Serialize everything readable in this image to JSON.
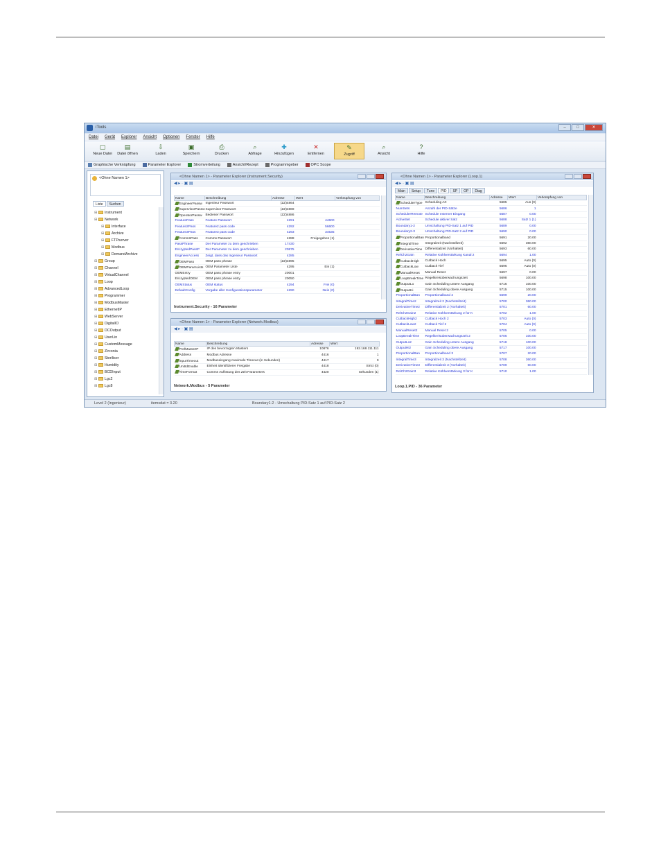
{
  "app": {
    "title": "iTools"
  },
  "menu": [
    "Datei",
    "Gerät",
    "Explorer",
    "Ansicht",
    "Optionen",
    "Fenster",
    "Hilfe"
  ],
  "toolbar": [
    {
      "label": "Neue Datei",
      "icon": "new-file-icon"
    },
    {
      "label": "Datei öffnen",
      "icon": "open-file-icon"
    },
    {
      "label": "Laden",
      "icon": "load-icon"
    },
    {
      "label": "Speichern",
      "icon": "save-icon"
    },
    {
      "label": "Drucken",
      "icon": "print-icon"
    },
    {
      "label": "Abfrage",
      "icon": "scan-icon"
    },
    {
      "label": "Hinzufügen",
      "icon": "add-icon"
    },
    {
      "label": "Entfernen",
      "icon": "remove-icon"
    },
    {
      "label": "Zugriff",
      "icon": "access-icon"
    },
    {
      "label": "Ansicht",
      "icon": "view-icon"
    },
    {
      "label": "Hilfe",
      "icon": "help-icon"
    }
  ],
  "views": [
    "Graphische Verknüpfung",
    "Parameter Explorer",
    "Stromverteilung",
    "Ansicht/Rezept",
    "Programmgeber",
    "OPC Scope"
  ],
  "tree": {
    "root": "<Ohne Namen 1>",
    "tabs": [
      "Liste",
      "Suchen"
    ],
    "items": [
      "Instrument",
      "Network",
      "Interface",
      "Archive",
      "FTPserver",
      "Modbus",
      "DemandArchive",
      "Group",
      "Channel",
      "VirtualChannel",
      "Loop",
      "AdvancedLoop",
      "Programmer",
      "ModbusMaster",
      "EthernetIP",
      "WebServer",
      "DigitalIO",
      "DCOutput",
      "UserLin",
      "CustomMessage",
      "Zirconia",
      "Steriliser",
      "Humidity",
      "BCDInput",
      "Lgc2",
      "Lgc8"
    ]
  },
  "security_panel": {
    "title": "<Ohne Namen 1> - Parameter Explorer (Instrument.Security)",
    "headers": [
      "Name",
      "Beschreibung",
      "Adresse",
      "Wert",
      "Verknüpfung von"
    ],
    "rows": [
      [
        "EngineerPassw",
        "Ingenieur Passwort",
        "(ZZ)4864",
        ""
      ],
      [
        "SupervisorPassw",
        "Supervisor Passwort",
        "(ZZ)4869",
        ""
      ],
      [
        "OperatorPassw",
        "Bediener Passwort",
        "(ZZ)4886",
        ""
      ],
      [
        "FeaturePass",
        "Feature Passwort",
        "4291",
        "44600"
      ],
      [
        "Feature2Pass",
        "Feature2 pass code",
        "4292",
        "56600"
      ],
      [
        "Feature3Pass",
        "Feature3 pass code",
        "4293",
        "34635"
      ],
      [
        "CommsPass",
        "Comms Passwort",
        "4288",
        "Freigegeben (1)"
      ],
      [
        "PassPhrase",
        "Der Parameter zu dem geschrieben",
        "17430",
        ""
      ],
      [
        "EncryptedPassP",
        "Der Parameter zu dem geschrieben",
        "20875",
        ""
      ],
      [
        "EngineerAccess",
        "Zeigt, dass das Ingenieur Passwort",
        "4285",
        ""
      ],
      [
        "OEMPass",
        "OEM pass phrase",
        "(ZZ)4895",
        ""
      ],
      [
        "OEMParamLists",
        "OEM Parameter Liste",
        "4295",
        "Ein (1)"
      ],
      [
        "OEMEntry",
        "OEM pass phrase entry",
        "20001",
        ""
      ],
      [
        "EncryptedOEM",
        "OEM pass phrase entry",
        "20050",
        ""
      ],
      [
        "OEMStatus",
        "OEM status",
        "4294",
        "Frei (0)"
      ],
      [
        "DefaultConfig",
        "Vorgabe aller Konfigurationsparameter",
        "4290",
        "Nein (0)"
      ]
    ],
    "status": "Instrument.Security",
    "count": "16 Parameter"
  },
  "modbus_panel": {
    "title": "<Ohne Namen 1> - Parameter Explorer (Network.Modbus)",
    "headers": [
      "Name",
      "Beschreibung",
      "Adresse",
      "Wert"
    ],
    "rows": [
      [
        "PrefMasterIP",
        "IP des bevorzugten Masters",
        "10876",
        "192.168.111.111"
      ],
      [
        "Address",
        "Modbus Adresse",
        "4416",
        "1"
      ],
      [
        "InputTimeout",
        "Modbuseingang maximale Timeout (in Sekunden)",
        "4417",
        "0"
      ],
      [
        "UnitIdEnable",
        "Einheit Identifizierer Freigabe",
        "4418",
        "Strict (0)"
      ],
      [
        "TimeFormat",
        "Comms Auflösung des Zeit Parameters",
        "4420",
        "Sekunden (1)"
      ]
    ],
    "status": "Network.Modbus",
    "count": "5 Parameter"
  },
  "loop_panel": {
    "title": "<Ohne Namen 1> - Parameter Explorer (Loop.1)",
    "tabs": [
      "Main",
      "Setup",
      "Tune",
      "PID",
      "SP",
      "OP",
      "Diag"
    ],
    "active_tab": "PID",
    "headers": [
      "Name",
      "Beschreibung",
      "Adresse",
      "Wert",
      "Verknüpfung von"
    ],
    "rows": [
      [
        "SchedulerType",
        "Scheduling Art",
        "5685",
        "Aus (0)"
      ],
      [
        "NumSets",
        "Anzahl der PID-Sätze",
        "5686",
        "1"
      ],
      [
        "SchedulerRemote",
        "Schedule externer Eingang",
        "5687",
        "0.00"
      ],
      [
        "ActiveSet",
        "Schedule aktiver Satz",
        "5688",
        "Satz 1 (1)"
      ],
      [
        "Boundary1-2",
        "Umschaltung PID-Satz 1 auf PID",
        "5689",
        "0.00"
      ],
      [
        "Boundary2-3",
        "Umschaltung PID-Satz 2 auf PID",
        "5690",
        "0.00"
      ],
      [
        "ProportionalBan",
        "Proportionalband",
        "5691",
        "20.00"
      ],
      [
        "IntegralTime",
        "Integralzeit (Nachstellzeit)",
        "5692",
        "360.00"
      ],
      [
        "DerivativeTime",
        "Differentialzeit (Vorhalteit)",
        "5693",
        "60.00"
      ],
      [
        "RelCh2Gain",
        "Relative Kühlverstärkung Kanal 2",
        "5694",
        "1.00"
      ],
      [
        "CutbackHigh",
        "Cutback Hoch",
        "5695",
        "Auto (0)"
      ],
      [
        "CutbackLow",
        "Cutback Tief",
        "5696",
        "Auto (0)"
      ],
      [
        "ManualReset",
        "Manual Reset",
        "5697",
        "0.00"
      ],
      [
        "LoopBreakTime",
        "Regelkreisüberwachungszeit",
        "5698",
        "100.00"
      ],
      [
        "OutputLo",
        "Gain Scheduling untere Ausgang",
        "5716",
        "100.00"
      ],
      [
        "OutputHi",
        "Gain Scheduling obere Ausgang",
        "5715",
        "100.00"
      ],
      [
        "ProportionalBan",
        "Proportionalband 2",
        "5699",
        "20.00"
      ],
      [
        "IntegralTime2",
        "Integralzeit 2 (Nachstellzeit)",
        "5700",
        "360.00"
      ],
      [
        "DerivativeTime2",
        "Differentialzeit 2 (Vorhalteit)",
        "5701",
        "60.00"
      ],
      [
        "RelCh2Gain2",
        "Relative Kühlverstärkung 2 für K",
        "5702",
        "1.00"
      ],
      [
        "CutbackHigh2",
        "Cutback Hoch 2",
        "5703",
        "Auto (0)"
      ],
      [
        "CutbackLow2",
        "Cutback Tief 2",
        "5704",
        "Auto (0)"
      ],
      [
        "ManualReset2",
        "Manual Reset 2",
        "5705",
        "0.00"
      ],
      [
        "LoopBreakTime",
        "Regelkreisüberwachungszeit 2",
        "5706",
        "100.00"
      ],
      [
        "OutputLo2",
        "Gain Scheduling untere Ausgang",
        "5718",
        "100.00"
      ],
      [
        "OutputHi2",
        "Gain Scheduling obere Ausgang",
        "5717",
        "100.00"
      ],
      [
        "ProportionalBan",
        "Proportionalband 3",
        "5707",
        "20.00"
      ],
      [
        "IntegralTime3",
        "Integralzeit 3 (Nachstellzeit)",
        "5708",
        "360.00"
      ],
      [
        "DerivativeTime3",
        "Differentialzeit 3 (Vorhalteit)",
        "5709",
        "60.00"
      ],
      [
        "RelCh2Gain3",
        "Relative Kühlverstärkung 3 für K",
        "5710",
        "1.00"
      ]
    ],
    "status": "Loop.1.PID",
    "count": "36 Parameter"
  },
  "statusbar": {
    "left": "Level 2 (Ingenieur)",
    "middle": "itemsdat = 3.20",
    "right": "Boundary1-2 - Umschaltung PID-Satz 1 auf PID-Satz 2"
  },
  "colors": {
    "blue_text": "#2233d6",
    "title_bg": "#bfd2ea",
    "accent": "#f6d88a"
  }
}
